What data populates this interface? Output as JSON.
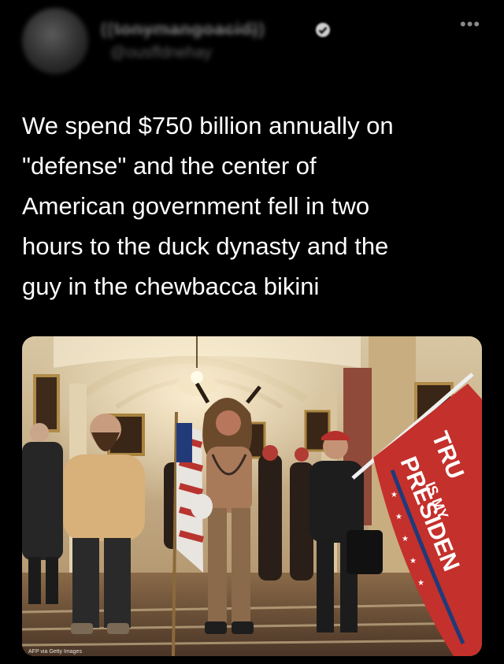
{
  "tweet": {
    "display_name": "((t̶o̶n̶y̶m̶a̶n̶g̶o̶a̶c̶i̶d̶))",
    "handle": "@ousffdnehay",
    "more_icon": "more-horizontal-icon",
    "verified_icon": "verified-badge-icon",
    "text": "We spend $750 billion annually on\n\"defense\" and the center of\nAmerican government fell in two\nhours to the duck dynasty and the\nguy in the chewbacca bikini"
  },
  "photo": {
    "flag_text_top": "TRU",
    "flag_text_mid": "IS MY",
    "flag_text_bottom": "PRESIDEN",
    "credit": "AFP via Getty Images"
  },
  "colors": {
    "background": "#000000",
    "text": "#ffffff",
    "flag_red": "#c4302b",
    "flag_blue": "#1f3a7a"
  }
}
